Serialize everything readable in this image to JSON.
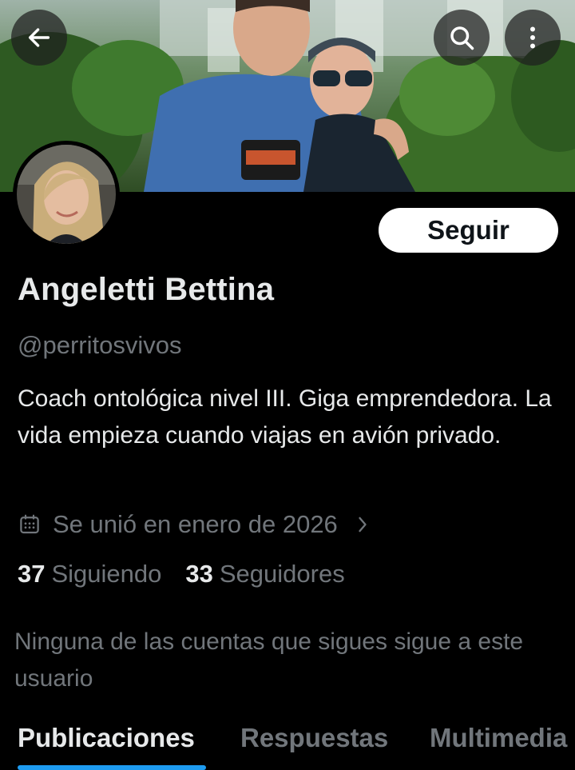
{
  "header": {
    "back_icon": "arrow-left-icon",
    "search_icon": "search-icon",
    "more_icon": "more-vertical-icon"
  },
  "profile": {
    "name": "Angeletti Bettina",
    "handle": "@perritosvivos",
    "bio": "Coach ontológica nivel III. Giga emprendedora. La vida empieza cuando viajas en avión privado.",
    "joined": "Se unió en enero de 2026",
    "joined_icon": "calendar-icon",
    "follow_label": "Seguir",
    "following_count": "37",
    "following_label": "Siguiendo",
    "followers_count": "33",
    "followers_label": "Seguidores",
    "mutual_text": "Ninguna de las cuentas que sigues sigue a este usuario"
  },
  "tabs": [
    {
      "label": "Publicaciones",
      "active": true
    },
    {
      "label": "Respuestas",
      "active": false
    },
    {
      "label": "Multimedia",
      "active": false
    }
  ],
  "colors": {
    "background": "#000000",
    "primary_text": "#e7e9ea",
    "secondary_text": "#71767b",
    "accent": "#1d9bf0",
    "button_bg": "#ffffff"
  }
}
